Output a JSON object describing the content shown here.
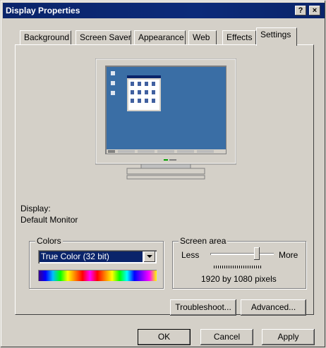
{
  "window": {
    "title": "Display Properties",
    "help": "?",
    "close": "×"
  },
  "tabs": [
    {
      "label": "Background"
    },
    {
      "label": "Screen Saver"
    },
    {
      "label": "Appearance"
    },
    {
      "label": "Web"
    },
    {
      "label": "Effects"
    },
    {
      "label": "Settings"
    }
  ],
  "display": {
    "label": "Display:",
    "value": "Default Monitor"
  },
  "colors": {
    "legend": "Colors",
    "selected": "True Color (32 bit)"
  },
  "screen_area": {
    "legend": "Screen area",
    "less": "Less",
    "more": "More",
    "resolution": "1920 by 1080 pixels",
    "slider_level": 0.73
  },
  "buttons": {
    "troubleshoot": "Troubleshoot...",
    "advanced": "Advanced...",
    "ok": "OK",
    "cancel": "Cancel",
    "apply": "Apply"
  },
  "colors_map": {
    "titlebar": "#0a246a",
    "desktop": "#3a6ea5",
    "face": "#d4d0c8"
  }
}
